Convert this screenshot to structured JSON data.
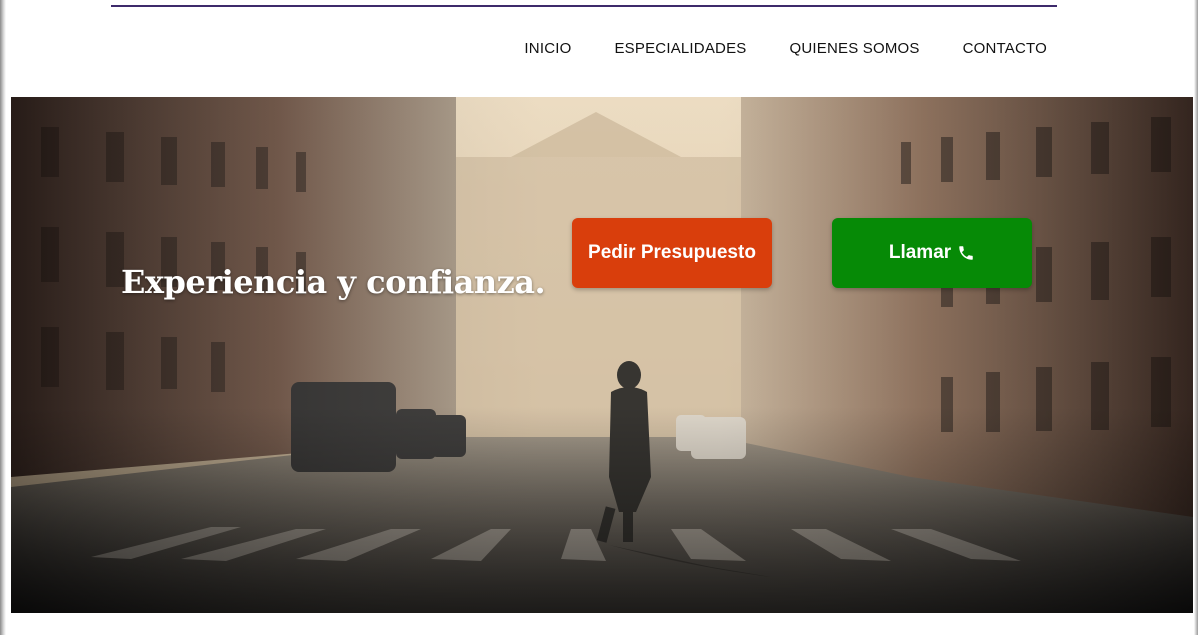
{
  "nav": {
    "items": [
      {
        "label": "INICIO"
      },
      {
        "label": "ESPECIALIDADES"
      },
      {
        "label": "QUIENES SOMOS"
      },
      {
        "label": "CONTACTO"
      }
    ]
  },
  "hero": {
    "title": "Experiencia y confianza.",
    "image": "city-street-pedestrian-crossing",
    "quote_button": {
      "label": "Pedir Presupuesto",
      "color": "#d93e0c"
    },
    "call_button": {
      "label": "Llamar",
      "icon": "phone-icon",
      "color": "#068a06"
    }
  },
  "colors": {
    "accent_rule": "#3d2a6b",
    "nav_text": "#111111"
  }
}
